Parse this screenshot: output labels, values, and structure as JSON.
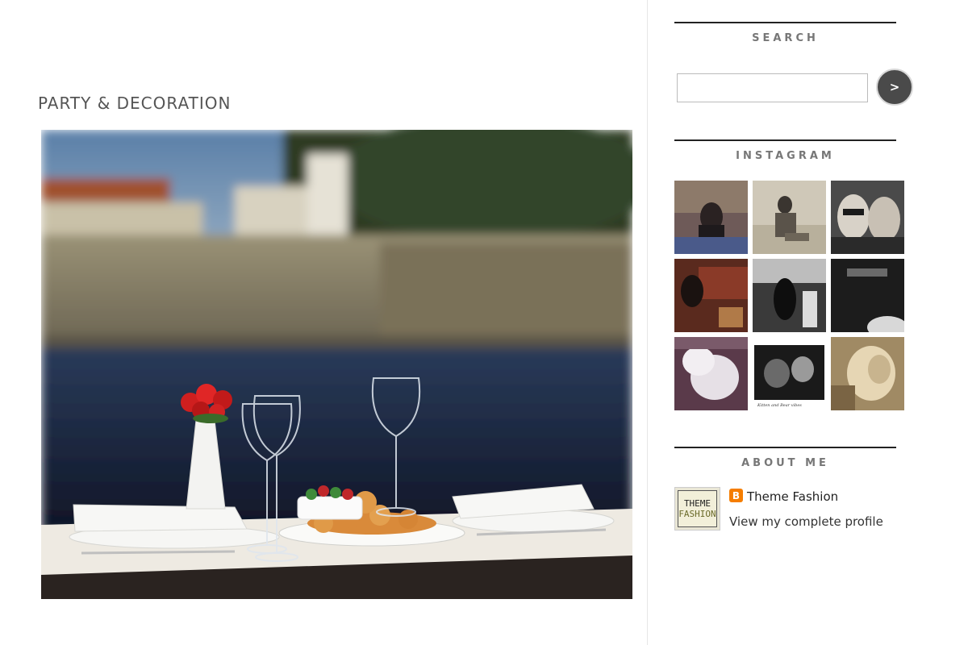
{
  "post": {
    "title": "PARTY & DECORATION"
  },
  "sidebar": {
    "search": {
      "title": "SEARCH",
      "input_value": "",
      "button_label": ">"
    },
    "instagram": {
      "title": "INSTAGRAM",
      "caption_7": "Kitten and Bear vibes"
    },
    "about": {
      "title": "ABOUT ME",
      "avatar_line1": "THEME",
      "avatar_line2": "FASHION",
      "blogger_icon": "B",
      "profile_name": "Theme Fashion",
      "profile_link": "View my complete profile"
    }
  },
  "colors": {
    "accent_dark": "#4a4a4a",
    "blogger_orange": "#f57d00",
    "rule": "#222222"
  }
}
